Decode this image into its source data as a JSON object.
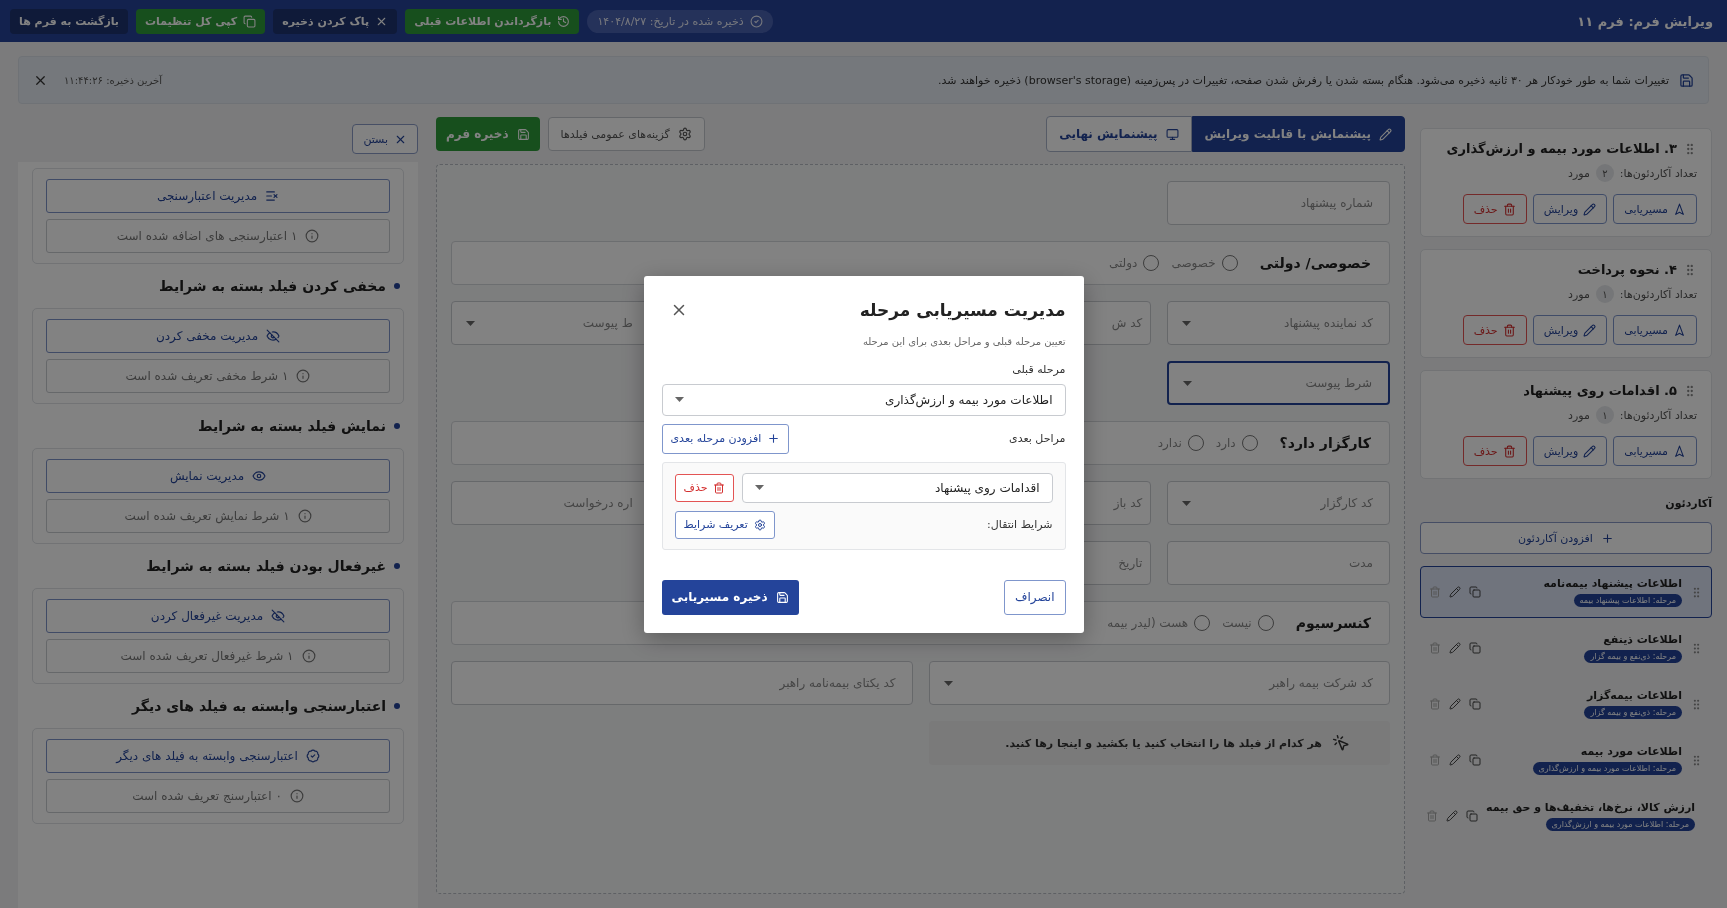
{
  "header": {
    "title": "ویرایش فرم: فرم ۱۱",
    "saved_badge": "ذخیره شده در تاریخ: ۱۴۰۴/۸/۲۷",
    "buttons": [
      {
        "label": "بازگرداندن اطلاعات قبلی",
        "kind": "restore"
      },
      {
        "label": "پاک کردن ذخیره",
        "kind": "clear"
      },
      {
        "label": "کپی کل تنظیمات",
        "kind": "copy"
      },
      {
        "label": "بازگشت به فرم ها",
        "kind": "back"
      }
    ]
  },
  "notice": {
    "text": "تغییرات شما به طور خودکار هر ۳۰ ثانیه ذخیره می‌شود. هنگام بسته شدن یا رفرش شدن صفحه، تغییرات در پس‌زمینه (browser's storage) ذخیره خواهند شد.",
    "last_saved": "آخرین ذخیره: ۱۱:۴۴:۲۶"
  },
  "stages_panel": {
    "stages": [
      {
        "title": "۳. اطلاعات مورد بیمه و ارزش‌گذاری",
        "count_label": "تعداد آکاردئون‌ها:",
        "count": "۲",
        "unit": "مورد",
        "actions": [
          {
            "label": "مسیریابی",
            "kind": "route"
          },
          {
            "label": "ویرایش",
            "kind": "edit"
          },
          {
            "label": "حذف",
            "kind": "delete"
          }
        ]
      },
      {
        "title": "۴. نحوه پرداخت",
        "count_label": "تعداد آکاردئون‌ها:",
        "count": "۱",
        "unit": "مورد",
        "actions": [
          {
            "label": "مسیریابی",
            "kind": "route"
          },
          {
            "label": "ویرایش",
            "kind": "edit"
          },
          {
            "label": "حذف",
            "kind": "delete"
          }
        ]
      },
      {
        "title": "۵. اقدامات روی پیشنهاد",
        "count_label": "تعداد آکاردئون‌ها:",
        "count": "۱",
        "unit": "مورد",
        "actions": [
          {
            "label": "مسیریابی",
            "kind": "route"
          },
          {
            "label": "ویرایش",
            "kind": "edit"
          },
          {
            "label": "حذف",
            "kind": "delete"
          }
        ]
      }
    ],
    "accordion_heading": "آکاردئون",
    "add_button": "افزودن آکاردئون",
    "accordions": [
      {
        "title": "اطلاعات پیشنهاد بیمه‌نامه",
        "stage": "مرحله: اطلاعات پیشنهاد بیمه",
        "selected": true
      },
      {
        "title": "اطلاعات ذینفع",
        "stage": "مرحله: ذی‌نفع و بیمه گزار",
        "selected": false
      },
      {
        "title": "اطلاعات بیمه‌گزار",
        "stage": "مرحله: ذی‌نفع و بیمه گزار",
        "selected": false
      },
      {
        "title": "اطلاعات مورد بیمه",
        "stage": "مرحله: اطلاعات مورد بیمه و ارزش‌گذاری",
        "selected": false
      },
      {
        "title": "ارزش کالا، نرخ‌ها، تخفیف‌ها و حق بیمه",
        "stage": "مرحله: اطلاعات مورد بیمه و ارزش‌گذاری",
        "selected": false
      }
    ]
  },
  "editor": {
    "tabs": [
      {
        "label": "پیشنمایش با قابلیت ویرایش",
        "selected": true
      },
      {
        "label": "پیشنمایش نهایی",
        "selected": false
      }
    ],
    "options_button": "گزینه‌های عمومی فیلدها",
    "save_button": "ذخیره فرم",
    "rows": [
      {
        "kind": "fields",
        "fields": [
          {
            "placeholder": "شماره پیشنهاد",
            "dropdown": false,
            "focused": false
          }
        ]
      },
      {
        "kind": "radio",
        "label": "خصوصی/ دولتی",
        "options": [
          {
            "label": "خصوصی",
            "selected": false
          },
          {
            "label": "دولتی",
            "selected": false
          }
        ]
      },
      {
        "kind": "fields",
        "fields": [
          {
            "placeholder": "کد نماینده پیشنهاد",
            "dropdown": true,
            "focused": false
          },
          {
            "placeholder": "کد ش",
            "focused": false
          },
          {
            "placeholder": "ط پیوست",
            "dropdown": true,
            "focused": false
          }
        ]
      },
      {
        "kind": "fields",
        "fields": [
          {
            "placeholder": "شرط پیوست",
            "dropdown": true,
            "focused": true
          }
        ]
      },
      {
        "kind": "radio",
        "label": "کارگزار دارد؟",
        "options": [
          {
            "label": "دارد",
            "selected": false
          },
          {
            "label": "ندارد",
            "selected": false
          }
        ]
      },
      {
        "kind": "fields",
        "fields": [
          {
            "placeholder": "کد کارگزار",
            "dropdown": true,
            "focused": false
          },
          {
            "placeholder": "کد باز",
            "focused": false
          },
          {
            "placeholder": "اره درخواست",
            "dropdown": false,
            "focused": false
          }
        ]
      },
      {
        "kind": "fields",
        "fields": [
          {
            "placeholder": "مدت",
            "dropdown": false,
            "focused": false
          },
          {
            "placeholder": "تاریخ",
            "focused": false
          }
        ]
      },
      {
        "kind": "radio",
        "label": "کنسرسیوم",
        "options": [
          {
            "label": "نیست",
            "selected": false
          },
          {
            "label": "هست (لیدر بیمه",
            "selected": false
          }
        ]
      },
      {
        "kind": "pair",
        "fields": [
          {
            "placeholder": "کد شرکت بیمه راهبر",
            "dropdown": true,
            "focused": false
          },
          {
            "placeholder": "کد یکتای بیمه‌نامه راهبر",
            "dropdown": false,
            "focused": false
          }
        ]
      }
    ],
    "drop_hint": "هر کدام از فیلد ها را انتخاب کنید یا بکشید و اینجا رها کنید."
  },
  "settings_panel": {
    "close_button": "بستن",
    "sections": [
      {
        "button": "مدیریت اعتبارسنجی",
        "kind": "validation",
        "info": "۱ اعتبارسنجی های اضافه شده است"
      },
      {
        "heading": "مخفی کردن فیلد بسته به شرایط",
        "button": "مدیریت مخفی کردن",
        "kind": "hide",
        "info": "۱ شرط مخفی تعریف شده است"
      },
      {
        "heading": "نمایش فیلد بسته به شرایط",
        "button": "مدیریت نمایش",
        "kind": "show",
        "info": "۱ شرط نمایش تعریف شده است"
      },
      {
        "heading": "غیرفعال بودن فیلد بسته به شرایط",
        "button": "مدیریت غیرفعال کردن",
        "kind": "disable",
        "info": "۱ شرط غیرفعال تعریف شده است"
      },
      {
        "heading": "اعتبارسنجی وابسته به فیلد های دیگر",
        "button": "اعتبارسنجی وابسته به فیلد های دیگر",
        "kind": "dependent",
        "info": "۰ اعتبارسنج تعریف شده است"
      }
    ]
  },
  "modal": {
    "title": "مدیریت مسیریابی مرحله",
    "subtitle": "تعیین مرحله قبلی و مراحل بعدی برای این مرحله",
    "previous_label": "مرحله قبلی",
    "previous_value": "اطلاعات مورد بیمه و ارزش‌گذاری",
    "next_label": "مراحل بعدی",
    "add_next_button": "افزودن مرحله بعدی",
    "next_steps": [
      {
        "value": "اقدامات روی پیشنهاد",
        "delete_button": "حذف",
        "conditions_label": "شرایط انتقال:",
        "conditions_button": "تعریف شرایط"
      }
    ],
    "cancel_button": "انصراف",
    "save_button": "ذخیره مسیریابی"
  }
}
